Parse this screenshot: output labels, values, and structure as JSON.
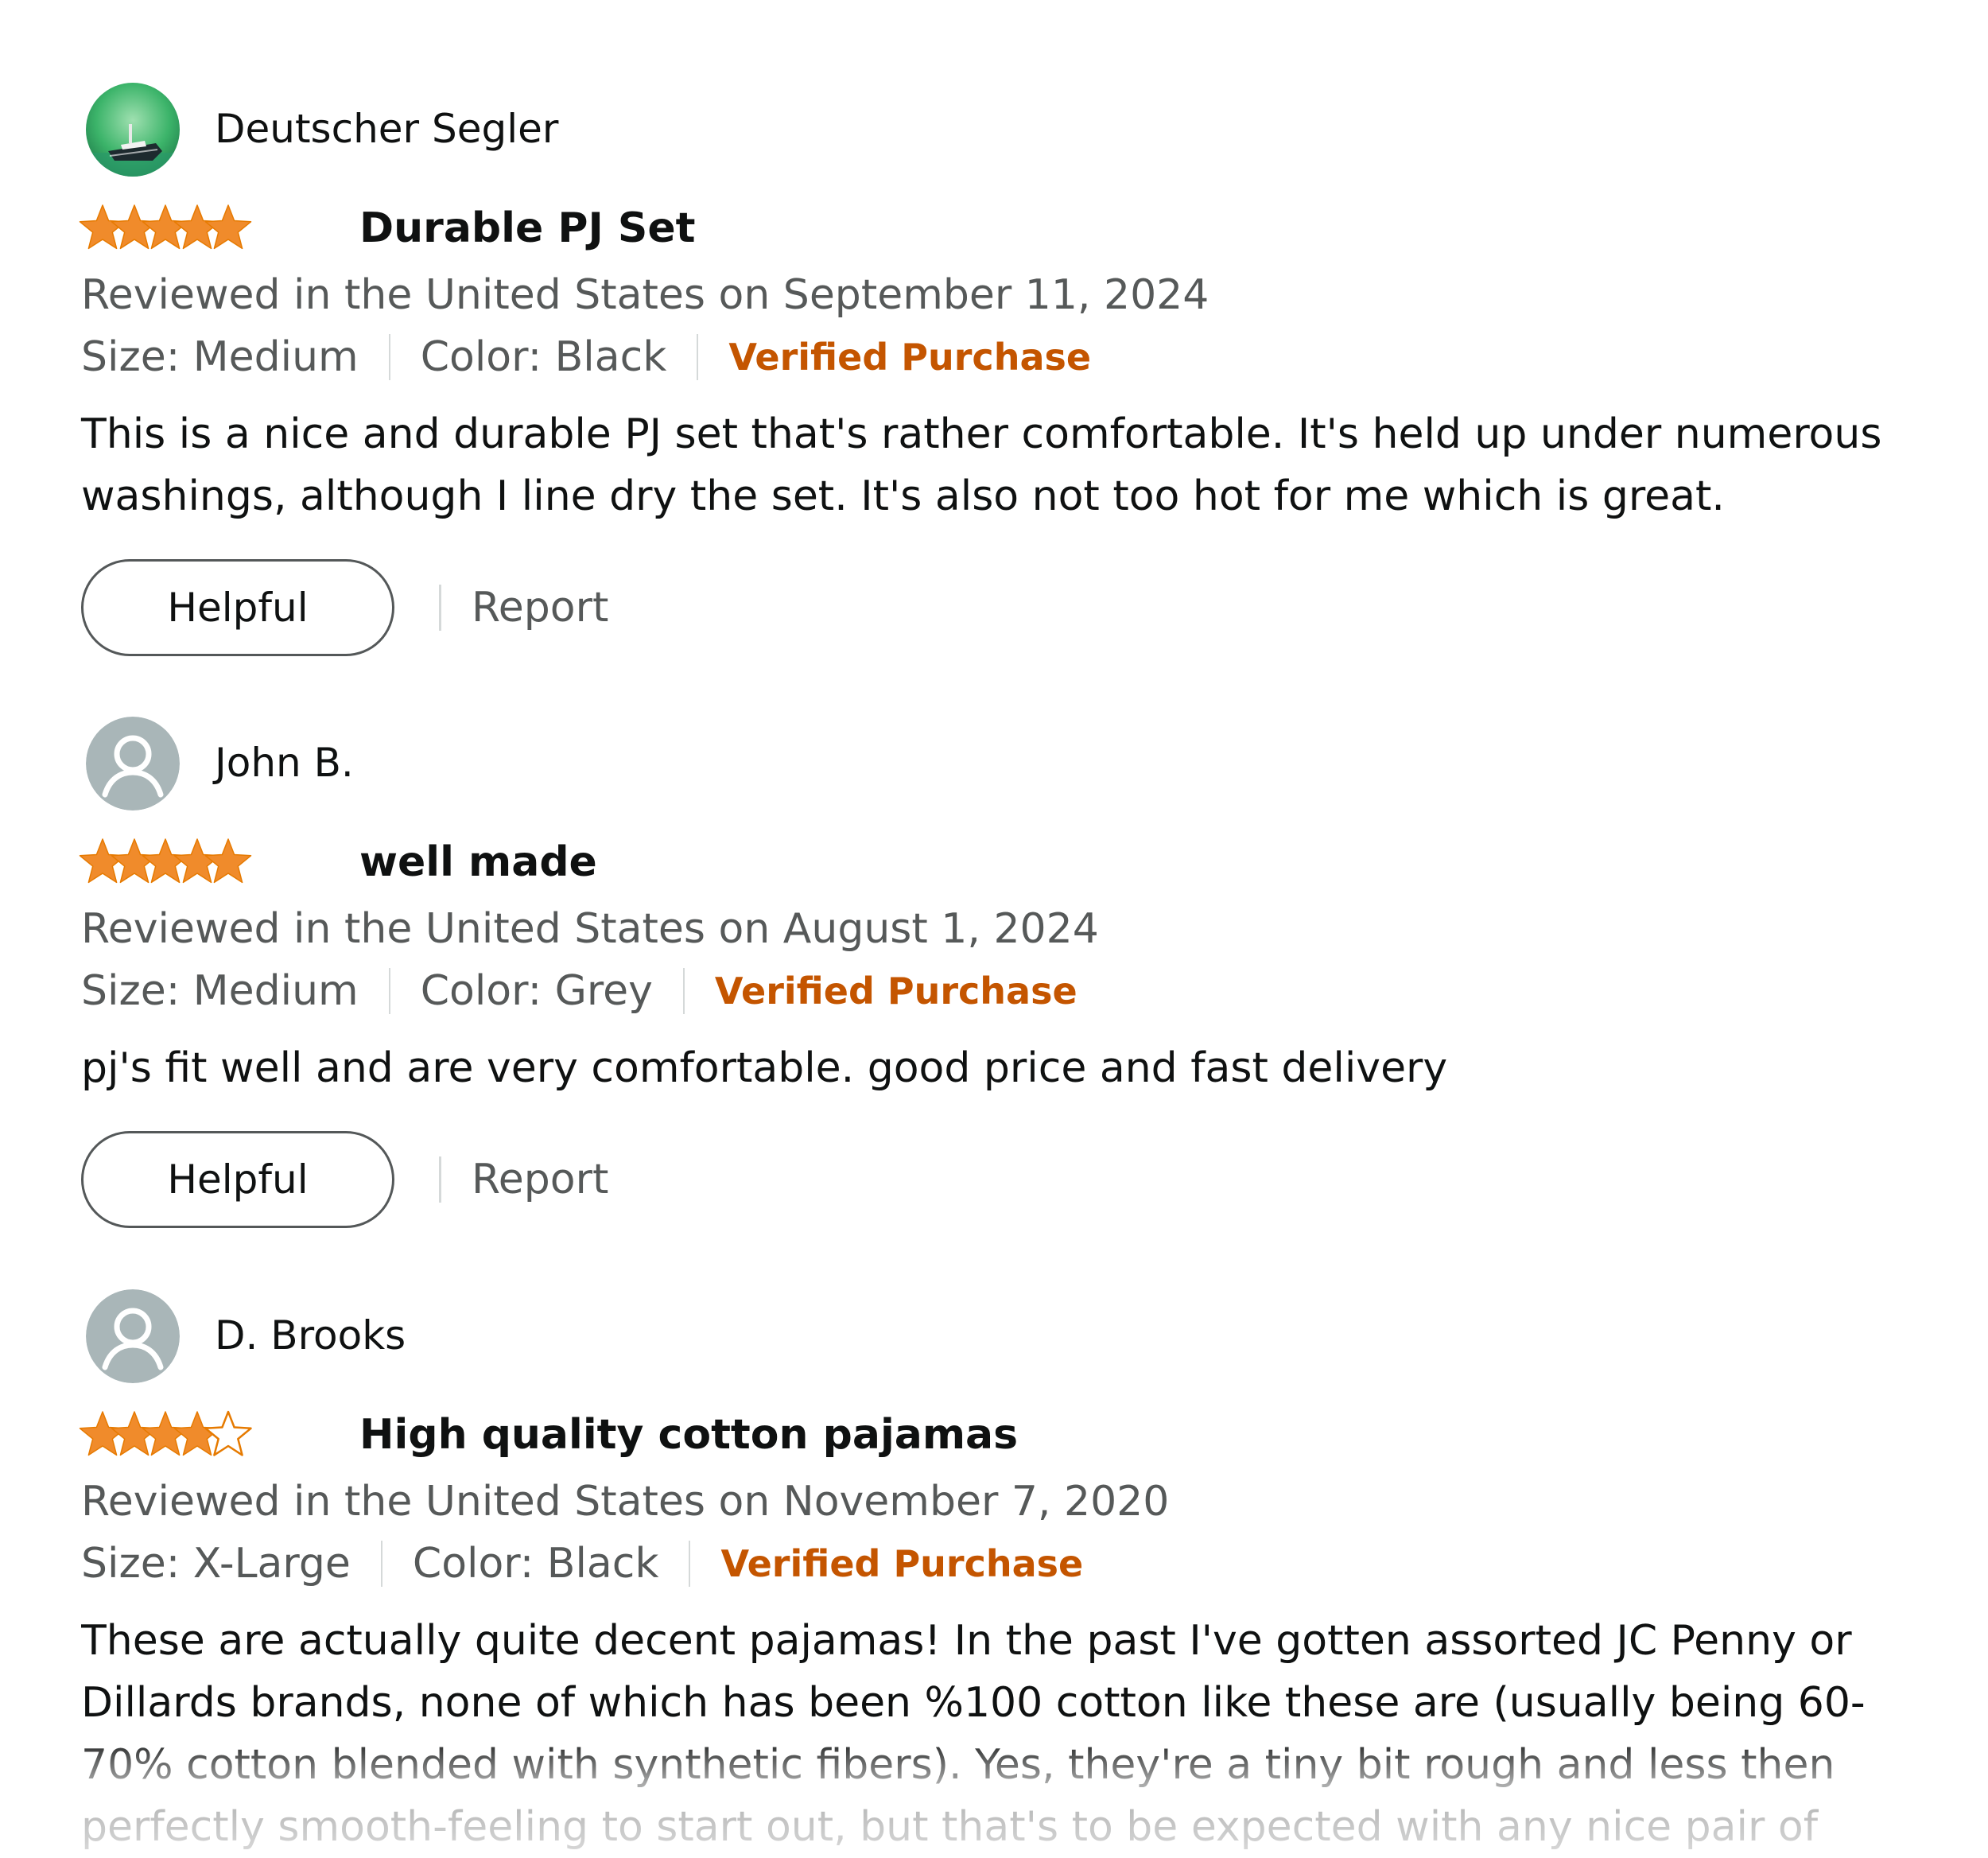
{
  "reviews": [
    {
      "profile_name": "Deutscher Segler",
      "avatar": "profile-photo-ship",
      "rating": 5,
      "rating_max": 5,
      "title": "Durable PJ Set",
      "date_line": "Reviewed in the United States on September 11, 2024",
      "size": "Size: Medium",
      "color": "Color: Black",
      "verified_label": "Verified Purchase",
      "body": "This is a nice and durable PJ set that's rather comfortable. It's held up under numerous washings, although I line dry the set. It's also not too hot for me which is great.",
      "helpful_label": "Helpful",
      "report_label": "Report"
    },
    {
      "profile_name": "John B.",
      "avatar": "default-user-icon",
      "rating": 5,
      "rating_max": 5,
      "title": "well made",
      "date_line": "Reviewed in the United States on August 1, 2024",
      "size": "Size: Medium",
      "color": "Color: Grey",
      "verified_label": "Verified Purchase",
      "body": "pj's fit well and are very comfortable. good price and fast delivery",
      "helpful_label": "Helpful",
      "report_label": "Report"
    },
    {
      "profile_name": "D. Brooks",
      "avatar": "default-user-icon",
      "rating": 4,
      "rating_max": 5,
      "title": "High quality cotton pajamas",
      "date_line": "Reviewed in the United States on November 7, 2020",
      "size": "Size: X-Large",
      "color": "Color: Black",
      "verified_label": "Verified Purchase",
      "body": "These are actually quite decent pajamas! In the past I've gotten assorted JC Penny or Dillards brands, none of which has been %100 cotton like these are (usually being 60-70% cotton blended with synthetic fibers). Yes, they're a tiny bit rough and less then perfectly smooth-feeling to start out, but that's to be expected with any nice pair of durable pajamas, in my"
    }
  ],
  "colors": {
    "star_fill": "#f08b2b",
    "star_outline": "#e67a00",
    "verified": "#c45500",
    "secondary_text": "#565959",
    "primary_text": "#0f1111",
    "avatar_default": "#a9b6b8"
  }
}
